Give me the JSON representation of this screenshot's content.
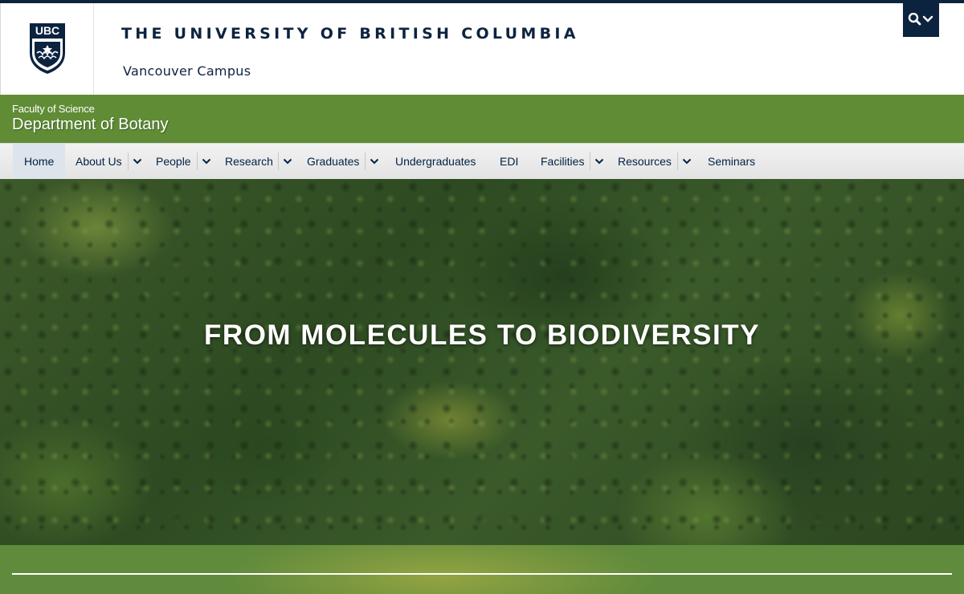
{
  "header": {
    "university_name": "THE UNIVERSITY OF BRITISH COLUMBIA",
    "campus": "Vancouver Campus",
    "crest_text": "UBC",
    "colors": {
      "navy": "#0c2340",
      "green": "#5f8c35"
    }
  },
  "unit": {
    "faculty": "Faculty of Science",
    "department": "Department of Botany"
  },
  "nav": {
    "items": [
      {
        "label": "Home",
        "active": true
      },
      {
        "label": "About Us",
        "has_dropdown": true
      },
      {
        "label": "People",
        "has_dropdown": true
      },
      {
        "label": "Research",
        "has_dropdown": true
      },
      {
        "label": "Graduates",
        "has_dropdown": true
      },
      {
        "label": "Undergraduates"
      },
      {
        "label": "EDI"
      },
      {
        "label": "Facilities",
        "has_dropdown": true
      },
      {
        "label": "Resources",
        "has_dropdown": true
      },
      {
        "label": "Seminars"
      }
    ]
  },
  "hero": {
    "title": "FROM MOLECULES TO BIODIVERSITY"
  },
  "icons": {
    "search": "search-icon",
    "chevron": "chevron-down-icon"
  }
}
